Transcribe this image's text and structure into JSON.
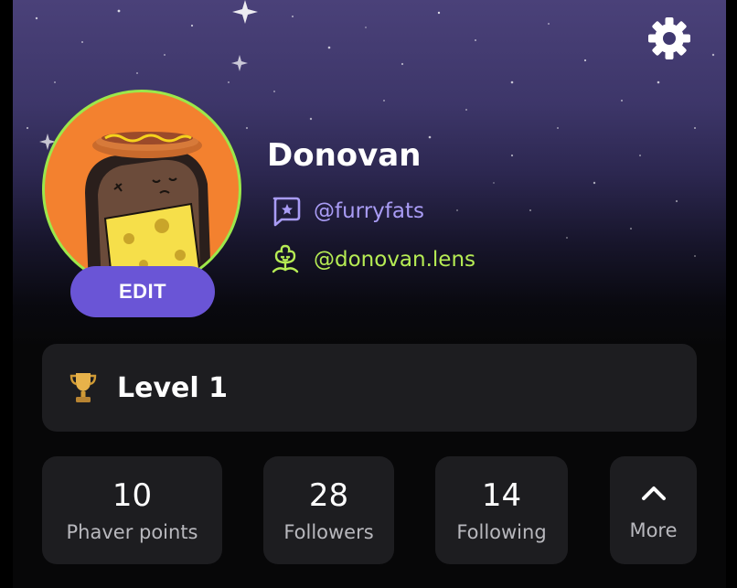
{
  "profile": {
    "name": "Donovan",
    "edit_label": "EDIT",
    "phaver_handle": "@furryfats",
    "lens_handle": "@donovan.lens"
  },
  "level": {
    "label": "Level 1",
    "icon": "trophy-icon"
  },
  "stats": {
    "points": {
      "value": "10",
      "label": "Phaver points"
    },
    "followers": {
      "value": "28",
      "label": "Followers"
    },
    "following": {
      "value": "14",
      "label": "Following"
    },
    "more": {
      "label": "More",
      "icon": "chevron-up-icon"
    }
  },
  "icons": {
    "settings": "gear-icon",
    "phaver": "phaver-chat-icon",
    "lens": "lens-icon"
  },
  "colors": {
    "accent_purple": "#6a55d6",
    "phaver_handle": "#a99cf5",
    "lens_handle": "#b6ec54",
    "avatar_ring": "#9ce84a",
    "avatar_bg": "#f3812f",
    "card_bg": "#1d1d20"
  }
}
